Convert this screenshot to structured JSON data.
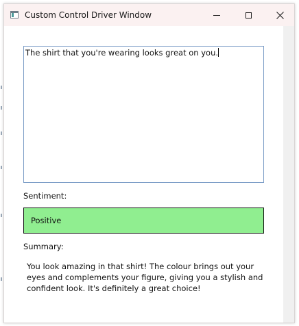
{
  "window": {
    "title": "Custom Control Driver Window",
    "buttons": {
      "minimize_icon": "minimize-icon",
      "maximize_icon": "maximize-icon",
      "close_icon": "close-icon"
    }
  },
  "input": {
    "value": "The shirt that you're wearing looks great on you."
  },
  "sentiment": {
    "label": "Sentiment:",
    "value": "Positive",
    "color": "#90ee90"
  },
  "summary": {
    "label": "Summary:",
    "text": "You look amazing in that shirt! The colour brings out your eyes and complements your figure, giving you a stylish and confident look. It's definitely a great choice!"
  }
}
